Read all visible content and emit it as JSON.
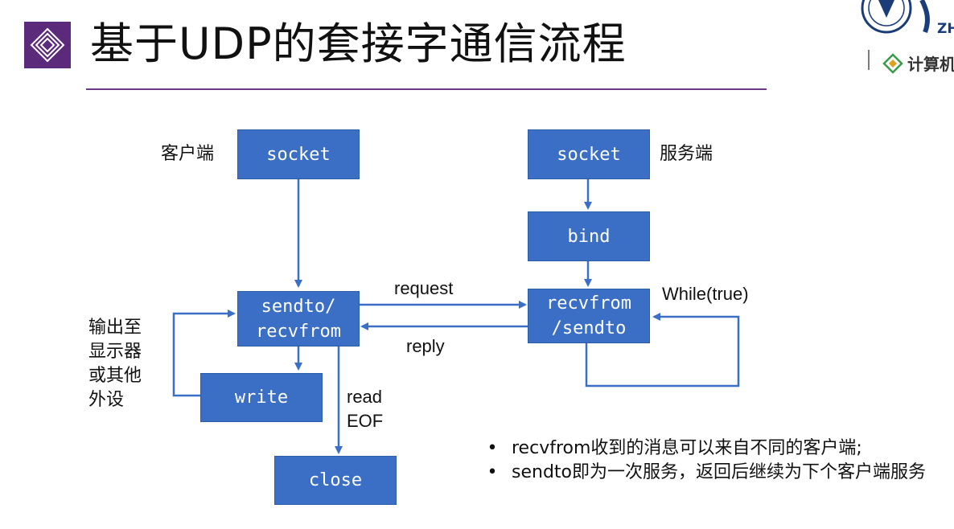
{
  "title": "基于UDP的套接字通信流程",
  "logo": {
    "text": "计算机",
    "abbrev": "ZH"
  },
  "client": {
    "label": "客户端",
    "socket": "socket",
    "sendto_recvfrom_line1": "sendto/",
    "sendto_recvfrom_line2": "recvfrom",
    "write": "write",
    "close": "close",
    "output_label": [
      "输出至",
      "显示器",
      "或其他",
      "外设"
    ],
    "read_eof_label": [
      "read",
      "EOF"
    ]
  },
  "server": {
    "label": "服务端",
    "socket": "socket",
    "bind": "bind",
    "recvfrom_sendto_line1": "recvfrom",
    "recvfrom_sendto_line2": "/sendto",
    "loop_label": "While(true)"
  },
  "messages": {
    "request": "request",
    "reply": "reply"
  },
  "notes": [
    "recvfrom收到的消息可以来自不同的客户端;",
    "sendto即为一次服务，返回后继续为下个客户端服务"
  ],
  "colors": {
    "box": "#3b6fc5",
    "arrow": "#3b6fc5",
    "title_rule": "#6b3a8a",
    "icon": "#5b2a7a"
  }
}
